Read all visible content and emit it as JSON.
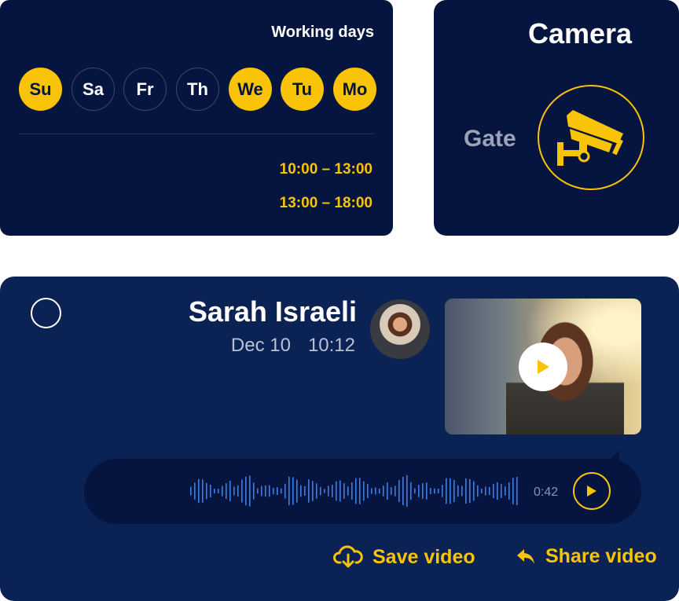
{
  "working_days": {
    "title": "Working days",
    "days": [
      {
        "label": "Su",
        "active": true
      },
      {
        "label": "Sa",
        "active": false
      },
      {
        "label": "Fr",
        "active": false
      },
      {
        "label": "Th",
        "active": false
      },
      {
        "label": "We",
        "active": true
      },
      {
        "label": "Tu",
        "active": true
      },
      {
        "label": "Mo",
        "active": true
      }
    ],
    "time_slots": [
      "10:00 – 13:00",
      "13:00 – 18:00"
    ]
  },
  "camera": {
    "title": "Camera",
    "location": "Gate",
    "icon": "security-camera-icon"
  },
  "message": {
    "sender": "Sarah Israeli",
    "date": "Dec 10",
    "time": "10:12",
    "audio_duration": "0:42",
    "actions": {
      "save_label": "Save video",
      "share_label": "Share video"
    }
  },
  "colors": {
    "card_bg": "#061440",
    "message_bg": "#0b2354",
    "accent": "#f9c307",
    "waveform": "#3d7fe0"
  }
}
